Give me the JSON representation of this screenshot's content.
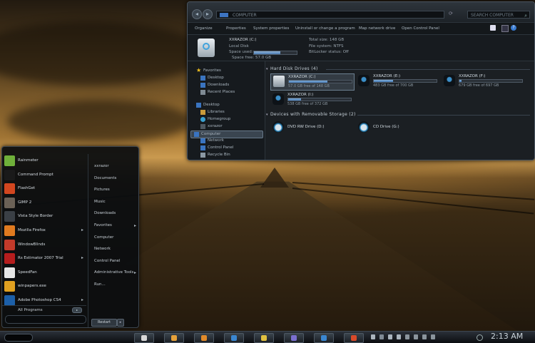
{
  "explorer": {
    "address": "COMPUTER",
    "search_placeholder": "SEARCH COMPUTER",
    "toolbar": [
      "Organize",
      "Properties",
      "System properties",
      "Uninstall or change a program",
      "Map network drive",
      "Open Control Panel"
    ],
    "details": {
      "name": "XXRAZOR (C:)",
      "type": "Local Disk",
      "space_used_label": "Space used:",
      "space_free": "Space free: 57.0 GB",
      "total_size": "Total size: 148 GB",
      "file_system": "File system: NTFS",
      "bitlocker": "BitLocker status: Off",
      "used_fraction": 0.61
    },
    "nav": {
      "favorites": "Favorites",
      "desktop_fav": "Desktop",
      "downloads": "Downloads",
      "recent": "Recent Places",
      "desktop": "Desktop",
      "libraries": "Libraries",
      "homegroup": "Homegroup",
      "user": "xxrazor",
      "computer": "Computer",
      "network": "Network",
      "control_panel": "Control Panel",
      "recycle_bin": "Recycle Bin"
    },
    "groups": {
      "hdd": "Hard Disk Drives (4)",
      "removable": "Devices with Removable Storage (2)"
    },
    "drives": [
      {
        "name": "XXRAZOR (C:)",
        "free": "57.0 GB free of 148 GB",
        "fill": 0.61
      },
      {
        "name": "XXRAZOR (E:)",
        "free": "483 GB free of 700 GB",
        "fill": 0.31
      },
      {
        "name": "XXRAZOR (F:)",
        "free": "679 GB free of 697 GB",
        "fill": 0.03
      },
      {
        "name": "XXRAZOR (I:)",
        "free": "538 GB free of 372 GB",
        "fill": 0.2
      }
    ],
    "removable": [
      {
        "name": "DVD RW Drive (D:)"
      },
      {
        "name": "CD Drive (G:)"
      }
    ]
  },
  "start_menu": {
    "programs": [
      {
        "label": "Rainmeter",
        "color": "#6fb03a",
        "arrow": ""
      },
      {
        "label": "Command Prompt",
        "color": "#1a1a1a",
        "arrow": ""
      },
      {
        "label": "FlashGet",
        "color": "#d2461f",
        "arrow": ""
      },
      {
        "label": "GIMP 2",
        "color": "#6b6156",
        "arrow": ""
      },
      {
        "label": "Vista Style Border",
        "color": "#3a3f45",
        "arrow": ""
      },
      {
        "label": "Mozilla Firefox",
        "color": "#e07a1f",
        "arrow": "▸"
      },
      {
        "label": "WindowBlinds",
        "color": "#c23a2a",
        "arrow": ""
      },
      {
        "label": "Rs Estimator 2007 Trial",
        "color": "#b51d1d",
        "arrow": "▸"
      },
      {
        "label": "SpeedFan",
        "color": "#e6e6e6",
        "arrow": ""
      },
      {
        "label": "winpapers.exe",
        "color": "#e0a020",
        "arrow": ""
      },
      {
        "label": "Adobe Photoshop CS4",
        "color": "#1c5fa8",
        "arrow": "▸"
      }
    ],
    "all_programs": "All Programs",
    "right_items": [
      {
        "label": "xxrazor",
        "arrow": ""
      },
      {
        "label": "Documents",
        "arrow": ""
      },
      {
        "label": "Pictures",
        "arrow": ""
      },
      {
        "label": "Music",
        "arrow": ""
      },
      {
        "label": "Downloads",
        "arrow": ""
      },
      {
        "label": "Favorites",
        "arrow": "▸"
      },
      {
        "label": "Computer",
        "arrow": ""
      },
      {
        "label": "Network",
        "arrow": ""
      },
      {
        "label": "Control Panel",
        "arrow": ""
      },
      {
        "label": "Administrative Tools",
        "arrow": "▸"
      },
      {
        "label": "Run...",
        "arrow": ""
      }
    ],
    "restart": "Restart"
  },
  "taskbar": {
    "clock": "2:13 AM",
    "buttons": [
      "#d8d8d8",
      "#e6a13a",
      "#e08a2a",
      "#3a86d0",
      "#e0c040",
      "#7a6fcf",
      "#3a86d0",
      "#d84a2a"
    ]
  }
}
